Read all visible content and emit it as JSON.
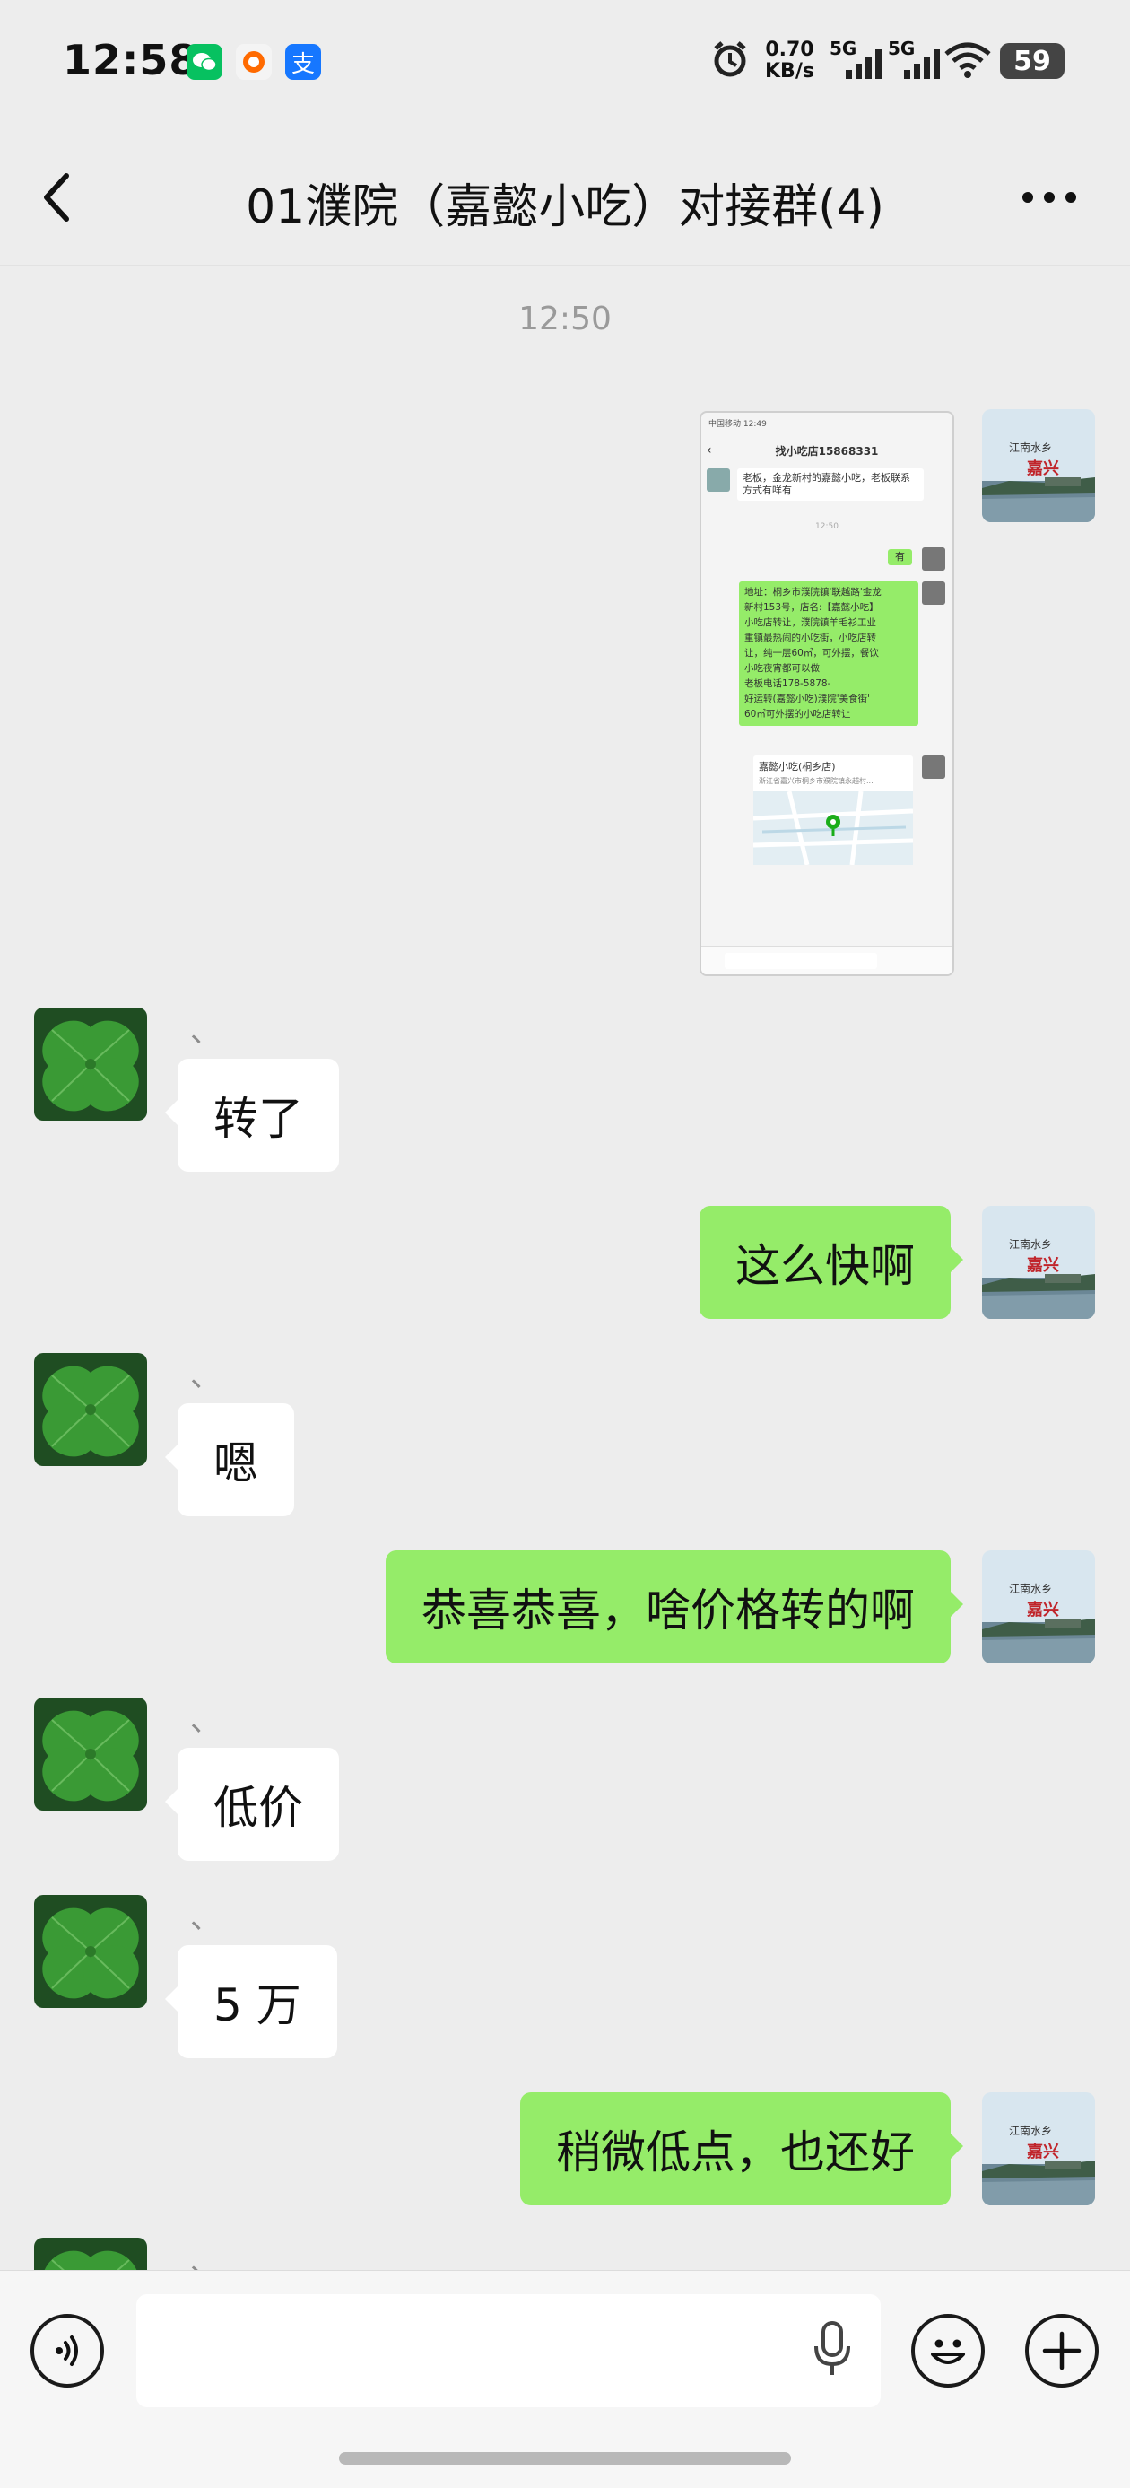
{
  "status": {
    "time": "12:58",
    "net_speed_value": "0.70",
    "net_speed_unit": "KB/s",
    "signal_1": "5G",
    "signal_2": "5G",
    "battery": "59",
    "alipay_glyph": "支"
  },
  "header": {
    "title": "01濮院（嘉懿小吃）对接群(4)"
  },
  "chat": {
    "timestamp": "12:50",
    "sender_name": "、",
    "messages": [
      {
        "side": "in",
        "text": "转了"
      },
      {
        "side": "out",
        "text": "这么快啊"
      },
      {
        "side": "in",
        "text": "嗯"
      },
      {
        "side": "out",
        "text": "恭喜恭喜，啥价格转的啊"
      },
      {
        "side": "in",
        "text": "低价"
      },
      {
        "side": "in",
        "text": "5 万"
      },
      {
        "side": "out",
        "text": "稍微低点，也还好"
      }
    ]
  },
  "screenshot": {
    "status": "中国移动 12:49",
    "title": "找小吃店15868331",
    "msg1": "老板，金龙新村的嘉懿小吃，老板联系方式有咩有",
    "time": "12:50",
    "reply": "有",
    "info_lines": [
      "地址：桐乡市濮院镇'联越路'金龙",
      "新村153号，店名:【嘉懿小吃】",
      "小吃店转让，濮院镇羊毛衫工业",
      "重镇最热闹的小吃街，小吃店转",
      "让，纯一层60㎡，可外摆，餐饮",
      "小吃夜宵都可以做",
      "老板电话178-5878-",
      "好运转(嘉懿小吃)濮院'美食街'",
      "60㎡可外摆的小吃店转让"
    ],
    "map_title": "嘉懿小吃(桐乡店)",
    "map_addr": "浙江省嘉兴市桐乡市濮院镇永越村..."
  },
  "avatar_text": {
    "line1": "江南水乡",
    "line2": "嘉兴"
  },
  "colors": {
    "background": "#ededed",
    "bubble_out": "#95ec69",
    "bubble_in": "#ffffff"
  }
}
